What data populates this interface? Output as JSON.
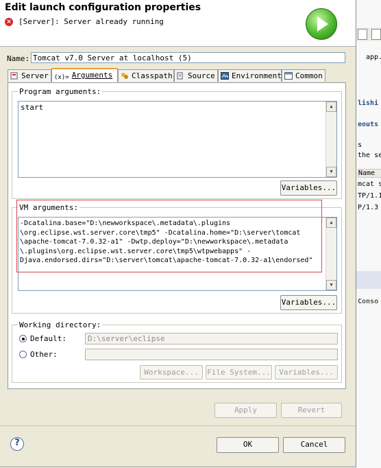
{
  "dialog": {
    "title": "Edit launch configuration properties",
    "message": "[Server]: Server already running",
    "name_label": "Name:",
    "name_value": "Tomcat v7.0 Server at localhost (5)"
  },
  "tabs": [
    {
      "label": "Server",
      "icon": "server-icon"
    },
    {
      "label": "Arguments",
      "icon": "arguments-icon",
      "active": true
    },
    {
      "label": "Classpath",
      "icon": "classpath-icon"
    },
    {
      "label": "Source",
      "icon": "source-icon"
    },
    {
      "label": "Environment",
      "icon": "environment-icon"
    },
    {
      "label": "Common",
      "icon": "common-icon"
    }
  ],
  "program_args": {
    "label": "Program arguments:",
    "value": "start",
    "variables_button": "Variables..."
  },
  "vm_args": {
    "label": "VM arguments:",
    "lines": [
      "-Dcatalina.base=\"D:\\newworkspace\\.metadata\\.plugins",
      "\\org.eclipse.wst.server.core\\tmp5\" -Dcatalina.home=\"D:\\server\\tomcat",
      "\\apache-tomcat-7.0.32-a1\" -Dwtp.deploy=\"D:\\newworkspace\\.metadata",
      "\\.plugins\\org.eclipse.wst.server.core\\tmp5\\wtpwebapps\" -",
      "Djava.endorsed.dirs=\"D:\\server\\tomcat\\apache-tomcat-7.0.32-a1\\endorsed\""
    ],
    "variables_button": "Variables..."
  },
  "working_dir": {
    "label": "Working directory:",
    "default_label": "Default:",
    "default_value": "D:\\server\\eclipse",
    "default_selected": true,
    "other_label": "Other:",
    "other_value": "",
    "workspace_button": "Workspace...",
    "filesystem_button": "File System...",
    "variables_button": "Variables..."
  },
  "apply_button": "Apply",
  "revert_button": "Revert",
  "ok_button": "OK",
  "cancel_button": "Cancel",
  "background": {
    "tab_label": "app.",
    "heading1": "lishi",
    "heading2": "eouts",
    "text1": "s",
    "text2": "the se",
    "col_name": "Name",
    "row1": "mcat s",
    "row2": "TP/1.1",
    "row3": "P/1.3",
    "console": "Conso"
  }
}
